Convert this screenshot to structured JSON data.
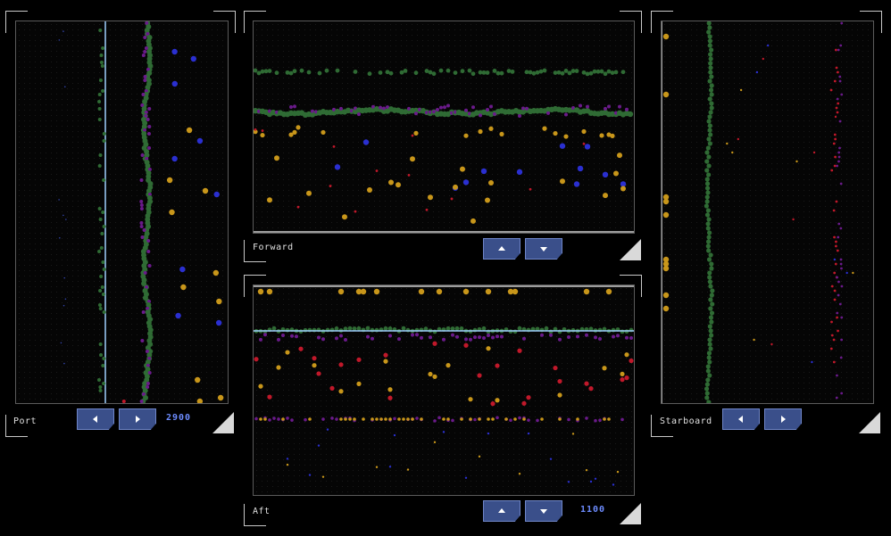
{
  "panels": {
    "port": {
      "label": "Port",
      "range_readout": "2900"
    },
    "forward": {
      "label": "Forward"
    },
    "aft": {
      "label": "Aft",
      "range_readout": "1100"
    },
    "starboard": {
      "label": "Starboard"
    }
  },
  "colors": {
    "green": "#2f6b34",
    "gold": "#c8961a",
    "blue": "#2a2fd0",
    "red": "#c0182a",
    "purple": "#6a1a8a",
    "cursor_line": "#9fd0ff",
    "button": "#3a4f8a",
    "readout": "#6d8cff"
  },
  "icons": {
    "left": "chevron-left-icon",
    "right": "chevron-right-icon",
    "up": "chevron-up-icon",
    "down": "chevron-down-icon",
    "resize": "resize-handle-icon"
  }
}
